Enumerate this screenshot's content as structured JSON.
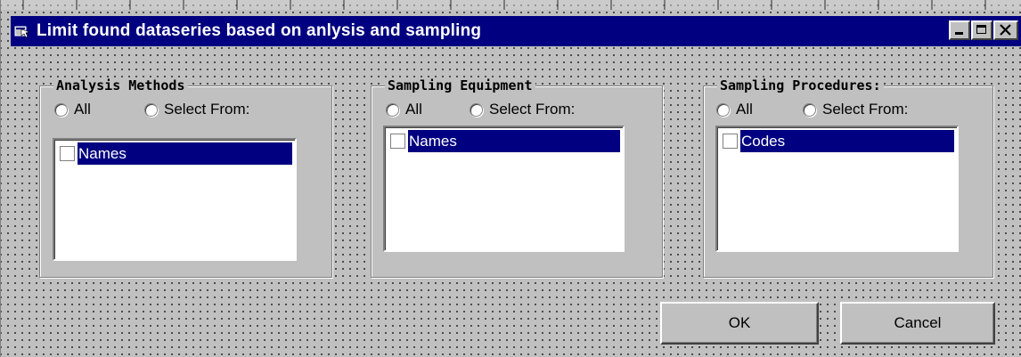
{
  "window": {
    "title": "Limit found dataseries based on anlysis and sampling"
  },
  "groups": [
    {
      "title": "Analysis Methods",
      "radio_all": "All",
      "radio_select": "Select From:",
      "list_item": "Names"
    },
    {
      "title": "Sampling Equipment",
      "radio_all": "All",
      "radio_select": "Select From:",
      "list_item": "Names"
    },
    {
      "title": "Sampling Procedures:",
      "radio_all": "All",
      "radio_select": "Select From:",
      "list_item": "Codes"
    }
  ],
  "buttons": {
    "ok_label": "OK",
    "cancel_label": "Cancel"
  },
  "icons": {
    "window_icon": "app-window-icon",
    "minimize": "minimize-icon",
    "maximize": "maximize-icon",
    "close": "close-icon"
  },
  "colors": {
    "titlebar": "#000080",
    "face": "#c0c0c0",
    "selection": "#000080"
  }
}
